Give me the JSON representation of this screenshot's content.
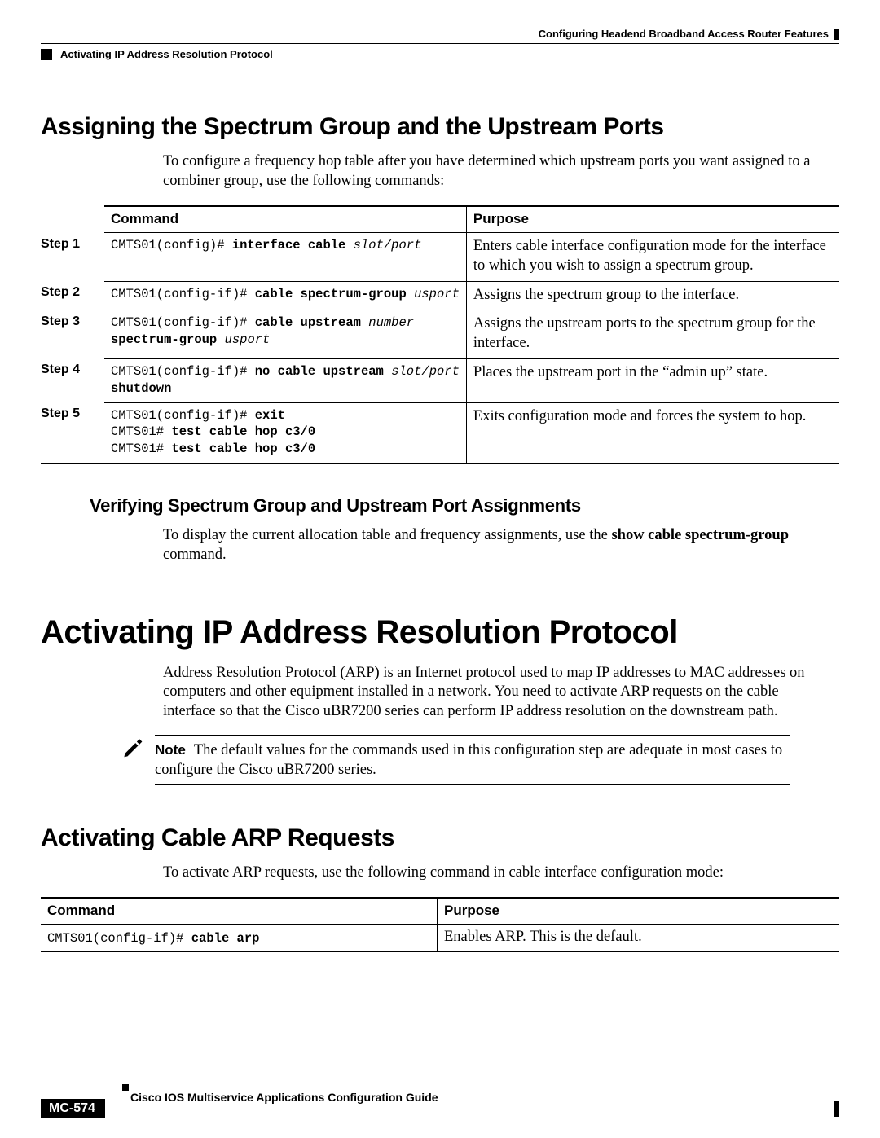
{
  "header": {
    "right": "Configuring Headend Broadband Access Router Features",
    "left": "Activating IP Address Resolution Protocol"
  },
  "section1": {
    "title": "Assigning the Spectrum Group and the Upstream Ports",
    "intro": "To configure a frequency hop table after you have determined which upstream ports you want assigned to a combiner group, use the following commands:"
  },
  "table1": {
    "head_command": "Command",
    "head_purpose": "Purpose",
    "rows": [
      {
        "step": "Step 1",
        "purpose": "Enters cable interface configuration mode for the interface to which you wish to assign a spectrum group.",
        "cmd_lines": [
          {
            "segments": [
              {
                "t": "CMTS01(config)# "
              },
              {
                "t": "interface cable",
                "s": "b"
              },
              {
                "t": " "
              },
              {
                "t": "slot/port",
                "s": "i"
              }
            ]
          }
        ]
      },
      {
        "step": "Step 2",
        "purpose": "Assigns the spectrum group to the interface.",
        "cmd_lines": [
          {
            "segments": [
              {
                "t": "CMTS01(config-if)# "
              },
              {
                "t": "cable spectrum-group",
                "s": "b"
              },
              {
                "t": " "
              },
              {
                "t": "usport",
                "s": "i"
              }
            ]
          }
        ]
      },
      {
        "step": "Step 3",
        "purpose": "Assigns the upstream ports to the spectrum group for the interface.",
        "cmd_lines": [
          {
            "segments": [
              {
                "t": "CMTS01(config-if)# "
              },
              {
                "t": "cable upstream",
                "s": "b"
              },
              {
                "t": " "
              },
              {
                "t": "number",
                "s": "i"
              }
            ]
          },
          {
            "segments": [
              {
                "t": "spectrum-group",
                "s": "b"
              },
              {
                "t": " "
              },
              {
                "t": "usport",
                "s": "i"
              }
            ]
          }
        ]
      },
      {
        "step": "Step 4",
        "purpose": "Places the upstream port in the “admin up” state.",
        "cmd_lines": [
          {
            "segments": [
              {
                "t": "CMTS01(config-if)# "
              },
              {
                "t": "no cable upstream",
                "s": "b"
              },
              {
                "t": " "
              },
              {
                "t": "slot/port",
                "s": "i"
              }
            ]
          },
          {
            "segments": [
              {
                "t": "shutdown",
                "s": "b"
              }
            ]
          }
        ]
      },
      {
        "step": "Step 5",
        "purpose": "Exits configuration mode and forces the system to hop.",
        "cmd_lines": [
          {
            "segments": [
              {
                "t": "CMTS01(config-if)# "
              },
              {
                "t": "exit",
                "s": "b"
              }
            ]
          },
          {
            "segments": [
              {
                "t": "CMTS01# "
              },
              {
                "t": "test cable hop c3/0",
                "s": "b"
              }
            ]
          },
          {
            "segments": [
              {
                "t": "CMTS01# "
              },
              {
                "t": "test cable hop c3/0",
                "s": "b"
              }
            ]
          }
        ]
      }
    ]
  },
  "subsection1": {
    "title": "Verifying Spectrum Group and Upstream Port Assignments",
    "body_parts": [
      {
        "t": "To display the current allocation table and frequency assignments, use the "
      },
      {
        "t": "show cable spectrum-group",
        "s": "b"
      },
      {
        "t": " command."
      }
    ]
  },
  "chapter": {
    "title": "Activating IP Address Resolution Protocol",
    "body": "Address Resolution Protocol (ARP) is an Internet protocol used to map IP addresses to MAC addresses on computers and other equipment installed in a network. You need to activate ARP requests on the cable interface so that the Cisco uBR7200 series can perform IP address resolution on the downstream path."
  },
  "note": {
    "label": "Note",
    "text": "The default values for the commands used in this configuration step are adequate in most cases to configure the Cisco uBR7200 series."
  },
  "section2": {
    "title": "Activating Cable ARP Requests",
    "body": "To activate ARP requests, use the following command in cable interface configuration mode:"
  },
  "table2": {
    "head_command": "Command",
    "head_purpose": "Purpose",
    "row": {
      "cmd_segments": [
        {
          "t": "CMTS01(config-if)# "
        },
        {
          "t": "cable arp",
          "s": "b"
        }
      ],
      "purpose": "Enables ARP. This is the default."
    }
  },
  "footer": {
    "guide": "Cisco IOS Multiservice Applications Configuration Guide",
    "page": "MC-574"
  }
}
